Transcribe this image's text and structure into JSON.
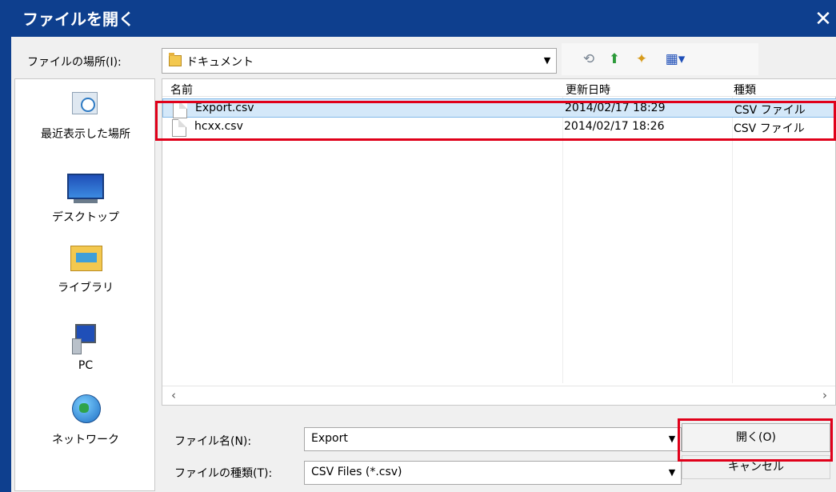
{
  "window": {
    "title": "ファイルを開く",
    "close_glyph": "✕"
  },
  "lookin": {
    "label": "ファイルの場所(I):",
    "value": "ドキュメント"
  },
  "places": [
    {
      "label": "最近表示した場所"
    },
    {
      "label": "デスクトップ"
    },
    {
      "label": "ライブラリ"
    },
    {
      "label": "PC"
    },
    {
      "label": "ネットワーク"
    }
  ],
  "columns": {
    "name": "名前",
    "date": "更新日時",
    "type": "種類"
  },
  "files": [
    {
      "name": "Export.csv",
      "date": "2014/02/17 18:29",
      "type": "CSV ファイル",
      "selected": true
    },
    {
      "name": "hcxx.csv",
      "date": "2014/02/17 18:26",
      "type": "CSV ファイル",
      "selected": false
    }
  ],
  "filename": {
    "label": "ファイル名(N):",
    "value": "Export"
  },
  "filetype": {
    "label": "ファイルの種類(T):",
    "value": "CSV Files (*.csv)"
  },
  "buttons": {
    "open": "開く(O)",
    "cancel": "キャンセル"
  },
  "icons": {
    "back": "back-icon",
    "up": "up-folder-icon",
    "new_folder": "new-folder-icon",
    "view": "view-menu-icon"
  },
  "colors": {
    "titlebar": "#0e3f8e",
    "highlight": "#e0001a",
    "selection": "#d4e8f9"
  }
}
